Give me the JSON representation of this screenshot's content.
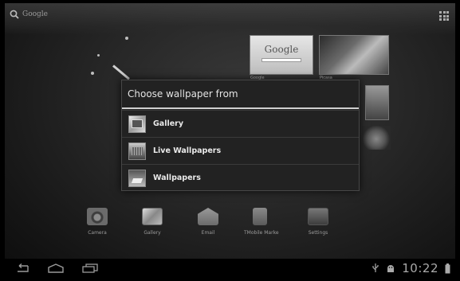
{
  "search": {
    "label": "Google"
  },
  "widgets": {
    "google_card": {
      "text": "Google",
      "footer": "Google"
    },
    "picasa_card": {
      "footer": "Picasa"
    }
  },
  "dialog": {
    "title": "Choose wallpaper from",
    "options": [
      {
        "label": "Gallery",
        "icon": "gallery-icon"
      },
      {
        "label": "Live Wallpapers",
        "icon": "live-wallpapers-icon"
      },
      {
        "label": "Wallpapers",
        "icon": "wallpapers-icon"
      }
    ]
  },
  "dock": [
    {
      "label": "Camera",
      "icon": "camera-icon"
    },
    {
      "label": "Gallery",
      "icon": "gallery-icon"
    },
    {
      "label": "Email",
      "icon": "email-icon"
    },
    {
      "label": "TMobile Marke",
      "icon": "tmobile-market-icon"
    },
    {
      "label": "Settings",
      "icon": "settings-icon"
    }
  ],
  "status_bar": {
    "time": "10:22"
  }
}
